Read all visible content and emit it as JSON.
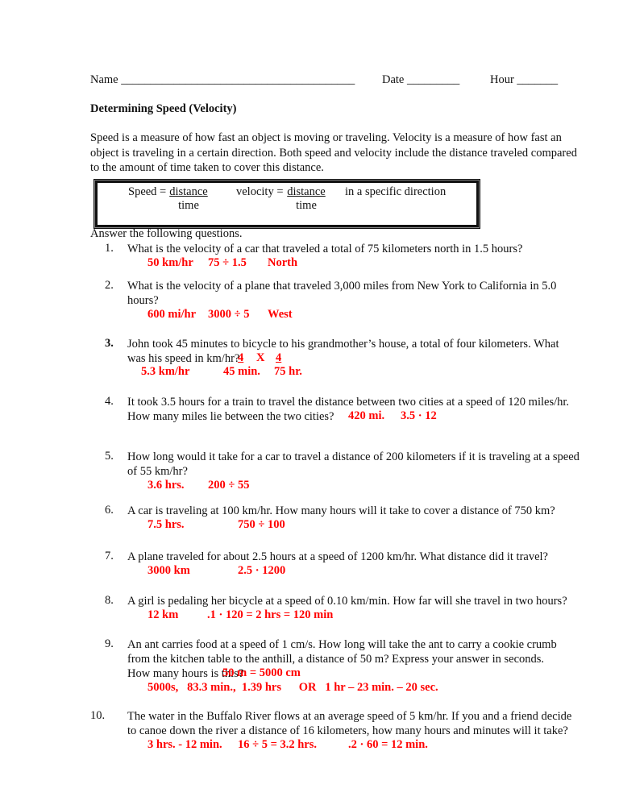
{
  "header": {
    "name_label": "Name ________________________________________",
    "date_label": "Date _________",
    "hour_label": "Hour _______"
  },
  "title": "Determining Speed (Velocity)",
  "intro": {
    "line1": "Speed is a measure of how fast an object is moving or traveling.  Velocity is a measure of how fast an",
    "line2": "object is traveling in a certain direction.  Both speed and velocity include the distance traveled compared",
    "line3": "to the amount of time taken to cover this distance."
  },
  "formula_box": {
    "speed_label": "Speed = ",
    "speed_num": "distance",
    "speed_den": "time",
    "velocity_label": "velocity = ",
    "velocity_num": "distance",
    "velocity_den": "time",
    "direction_note": "in a specific direction"
  },
  "instructions": "Answer the following questions.",
  "questions": [
    {
      "num": "1.",
      "lines": [
        "What is the velocity of a car that traveled a total of 75 kilometers north in 1.5 hours?"
      ],
      "answers": [
        "50 km/hr",
        "75 ÷ 1.5",
        "North"
      ]
    },
    {
      "num": "2.",
      "lines": [
        "What is the velocity of a plane that traveled 3,000 miles from New York to California in 5.0",
        "hours?"
      ],
      "answers": [
        "600  mi/hr",
        "3000  ÷  5",
        "West"
      ]
    },
    {
      "num": "3.",
      "lines": [
        "John took 45 minutes to bicycle to his grandmother’s house, a total of four kilometers.  What",
        "was his speed in km/hr?"
      ],
      "work_top": [
        "4",
        "X",
        "4"
      ],
      "answers": [
        "5.3 km/hr",
        "45 min.",
        "75 hr."
      ]
    },
    {
      "num": "4.",
      "lines": [
        "It took 3.5 hours for a train to travel the distance between two cities at a speed of 120 miles/hr.",
        "How many miles lie between the two cities?"
      ],
      "answers": [
        "420 mi.",
        "3.5  ·  12"
      ]
    },
    {
      "num": "5.",
      "lines": [
        "How long would it take for a car to travel a distance of 200 kilometers if it is traveling at a speed",
        "of 55 km/hr?"
      ],
      "answers": [
        "3.6  hrs.",
        "200 ÷ 55"
      ]
    },
    {
      "num": "6.",
      "lines": [
        "A car is traveling at 100 km/hr.  How many hours will it take to cover a distance of 750 km?"
      ],
      "answers": [
        "7.5 hrs.",
        "750 ÷ 100"
      ]
    },
    {
      "num": "7.",
      "lines": [
        "A plane traveled for about 2.5 hours at a speed of 1200 km/hr.  What distance did it travel?"
      ],
      "answers": [
        "3000 km",
        "2.5  ·  1200"
      ]
    },
    {
      "num": "8.",
      "lines": [
        "A girl is pedaling her bicycle at a speed of 0.10 km/min.  How far will she travel in two hours?"
      ],
      "answers": [
        "12 km",
        ".1  ·  120  =  2 hrs  =  120 min"
      ]
    },
    {
      "num": "9.",
      "lines": [
        "An ant carries food at a speed of 1 cm/s.  How long will take the ant to carry a cookie crumb",
        "from the kitchen table to the anthill, a distance of 50 m?  Express your answer in seconds.",
        "How many hours is this"
      ],
      "q_mark": "?",
      "inline_answer": "50 m  =  5000 cm",
      "answers": [
        "5000s,   83.3 min.,  1.39 hrs      OR   1 hr – 23 min. – 20 sec."
      ]
    },
    {
      "num": "10.",
      "lines": [
        "The water in the Buffalo River flows at an average speed of 5 km/hr.  If you and a friend decide",
        "to canoe down the river a distance of 16 kilometers, how many hours and minutes will it take?"
      ],
      "answers": [
        "3 hrs. - 12 min.",
        "16 ÷ 5 = 3.2 hrs.",
        ".2 · 60 = 12 min."
      ]
    }
  ],
  "colors": {
    "answer_red": "#ff0000",
    "text": "#111111"
  }
}
